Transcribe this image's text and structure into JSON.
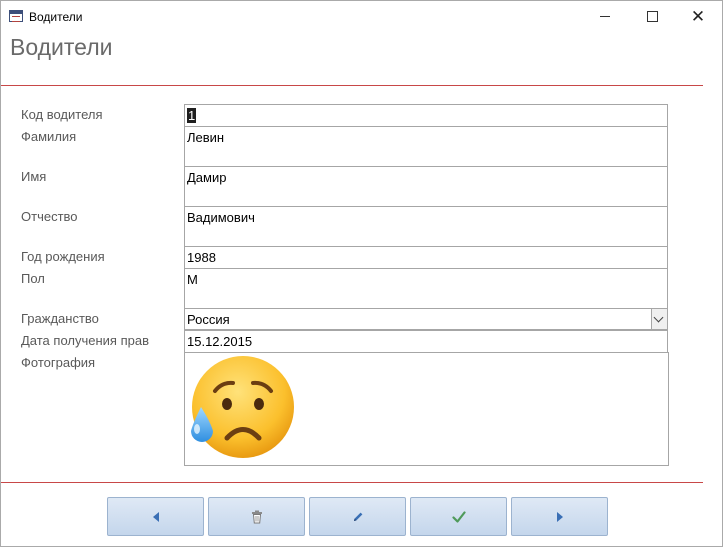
{
  "window": {
    "title": "Водители",
    "close_glyph": "✕"
  },
  "form": {
    "title": "Водители"
  },
  "fields": {
    "driver_code": {
      "label": "Код водителя",
      "value": "1"
    },
    "surname": {
      "label": "Фамилия",
      "value": "Левин"
    },
    "name": {
      "label": "Имя",
      "value": "Дамир"
    },
    "patronymic": {
      "label": "Отчество",
      "value": "Вадимович"
    },
    "birth_year": {
      "label": "Год рождения",
      "value": "1988"
    },
    "sex": {
      "label": "Пол",
      "value": "М"
    },
    "citizenship": {
      "label": "Гражданство",
      "value": "Россия"
    },
    "license_date": {
      "label": "Дата получения прав",
      "value": "15.12.2015"
    },
    "photo": {
      "label": "Фотография",
      "image": "sad-but-relieved-face-emoji"
    }
  },
  "nav_buttons": [
    {
      "name": "previous-record",
      "icon": "triangle-left-icon"
    },
    {
      "name": "delete-record",
      "icon": "trash-icon"
    },
    {
      "name": "edit-record",
      "icon": "pencil-icon"
    },
    {
      "name": "save-record",
      "icon": "checkmark-icon"
    },
    {
      "name": "next-record",
      "icon": "triangle-right-icon"
    }
  ],
  "colors": {
    "separator": "#c84848",
    "button_fill": "#cfdef0",
    "accent_icon": "#3a6fb5",
    "check_icon": "#4f9a5a"
  }
}
